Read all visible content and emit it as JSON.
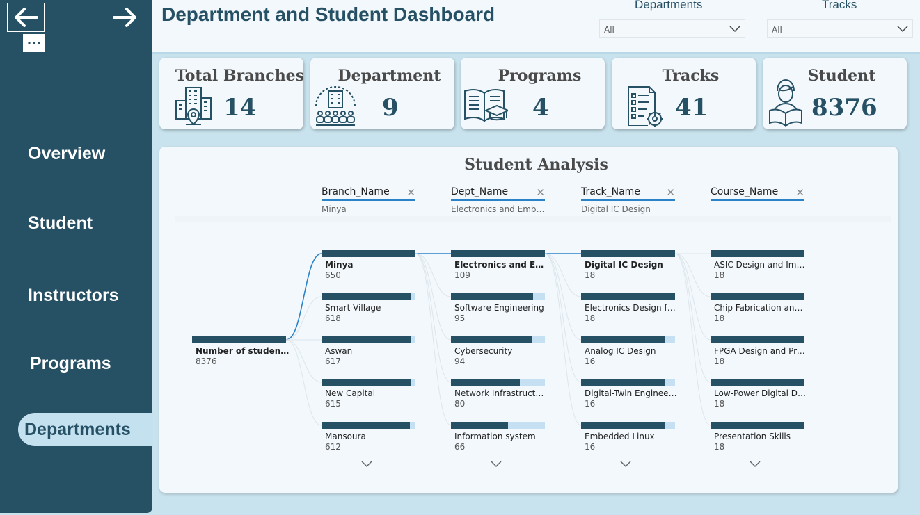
{
  "sidebar": {
    "items": [
      {
        "label": "Overview"
      },
      {
        "label": "Student"
      },
      {
        "label": "Instructors"
      },
      {
        "label": "Programs"
      },
      {
        "label": "Departments",
        "active": true
      }
    ]
  },
  "header": {
    "title": "Department and Student Dashboard",
    "filters": [
      {
        "label": "Departments",
        "value": "All"
      },
      {
        "label": "Tracks",
        "value": "All"
      }
    ]
  },
  "kpis": [
    {
      "title": "Total Branches",
      "value": "14",
      "icon": "building-location-icon"
    },
    {
      "title": "Department",
      "value": "9",
      "icon": "department-people-icon"
    },
    {
      "title": "Programs",
      "value": "4",
      "icon": "book-graduation-cap-icon"
    },
    {
      "title": "Tracks",
      "value": "41",
      "icon": "checklist-gear-icon"
    },
    {
      "title": "Student",
      "value": "8376",
      "icon": "student-reading-icon"
    }
  ],
  "analysis": {
    "title": "Student Analysis",
    "root": {
      "label": "Number of students",
      "value": 8376
    },
    "levels": [
      {
        "header": "Branch_Name",
        "selected": "Minya",
        "nodes": [
          {
            "label": "Minya",
            "value": 650,
            "selected": true
          },
          {
            "label": "Smart Village",
            "value": 618
          },
          {
            "label": "Aswan",
            "value": 617
          },
          {
            "label": "New Capital",
            "value": 615
          },
          {
            "label": "Mansoura",
            "value": 612
          }
        ]
      },
      {
        "header": "Dept_Name",
        "selected": "Electronics and Embed…",
        "nodes": [
          {
            "label": "Electronics and Emb…",
            "value": 109,
            "selected": true
          },
          {
            "label": "Software Engineering",
            "value": 95
          },
          {
            "label": "Cybersecurity",
            "value": 94
          },
          {
            "label": "Network Infrastructure…",
            "value": 80
          },
          {
            "label": "Information system",
            "value": 66
          }
        ]
      },
      {
        "header": "Track_Name",
        "selected": "Digital IC Design",
        "nodes": [
          {
            "label": "Digital IC Design",
            "value": 18,
            "selected": true
          },
          {
            "label": "Electronics Design for I…",
            "value": 18
          },
          {
            "label": "Analog IC Design",
            "value": 16
          },
          {
            "label": "Digital-Twin Engineering",
            "value": 16
          },
          {
            "label": "Embedded Linux",
            "value": 16
          }
        ]
      },
      {
        "header": "Course_Name",
        "selected": "",
        "nodes": [
          {
            "label": "ASIC Design and Imple…",
            "value": 18
          },
          {
            "label": "Chip Fabrication and …",
            "value": 18
          },
          {
            "label": "FPGA Design and Prot…",
            "value": 18
          },
          {
            "label": "Low-Power Digital Des…",
            "value": 18
          },
          {
            "label": "Presentation Skills",
            "value": 18
          }
        ]
      }
    ]
  }
}
